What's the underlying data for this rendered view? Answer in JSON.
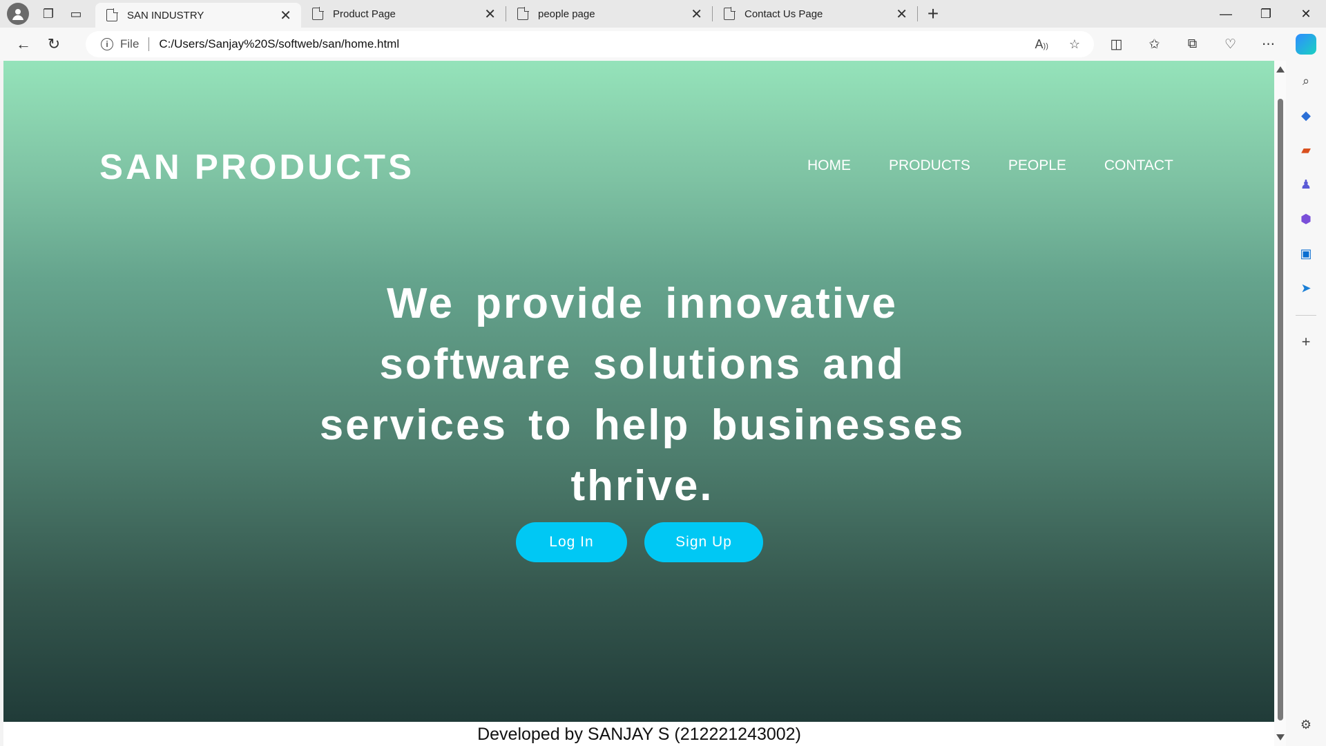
{
  "browser": {
    "tabs": [
      {
        "title": "SAN INDUSTRY",
        "active": true
      },
      {
        "title": "Product Page",
        "active": false
      },
      {
        "title": "people page",
        "active": false
      },
      {
        "title": "Contact Us Page",
        "active": false
      }
    ],
    "address": {
      "scheme_label": "File",
      "url": "C:/Users/Sanjay%20S/softweb/san/home.html"
    }
  },
  "page": {
    "brand": "SAN PRODUCTS",
    "nav": [
      "HOME",
      "PRODUCTS",
      "PEOPLE",
      "CONTACT"
    ],
    "headline": "We provide innovative software solutions and services to help businesses thrive.",
    "buttons": {
      "login": "Log In",
      "signup": "Sign Up"
    },
    "footer": "Developed by SANJAY S (212221243002)"
  },
  "colors": {
    "hero_top": "#95e3ba",
    "hero_bottom": "#203b38",
    "button": "#00c8f4"
  }
}
